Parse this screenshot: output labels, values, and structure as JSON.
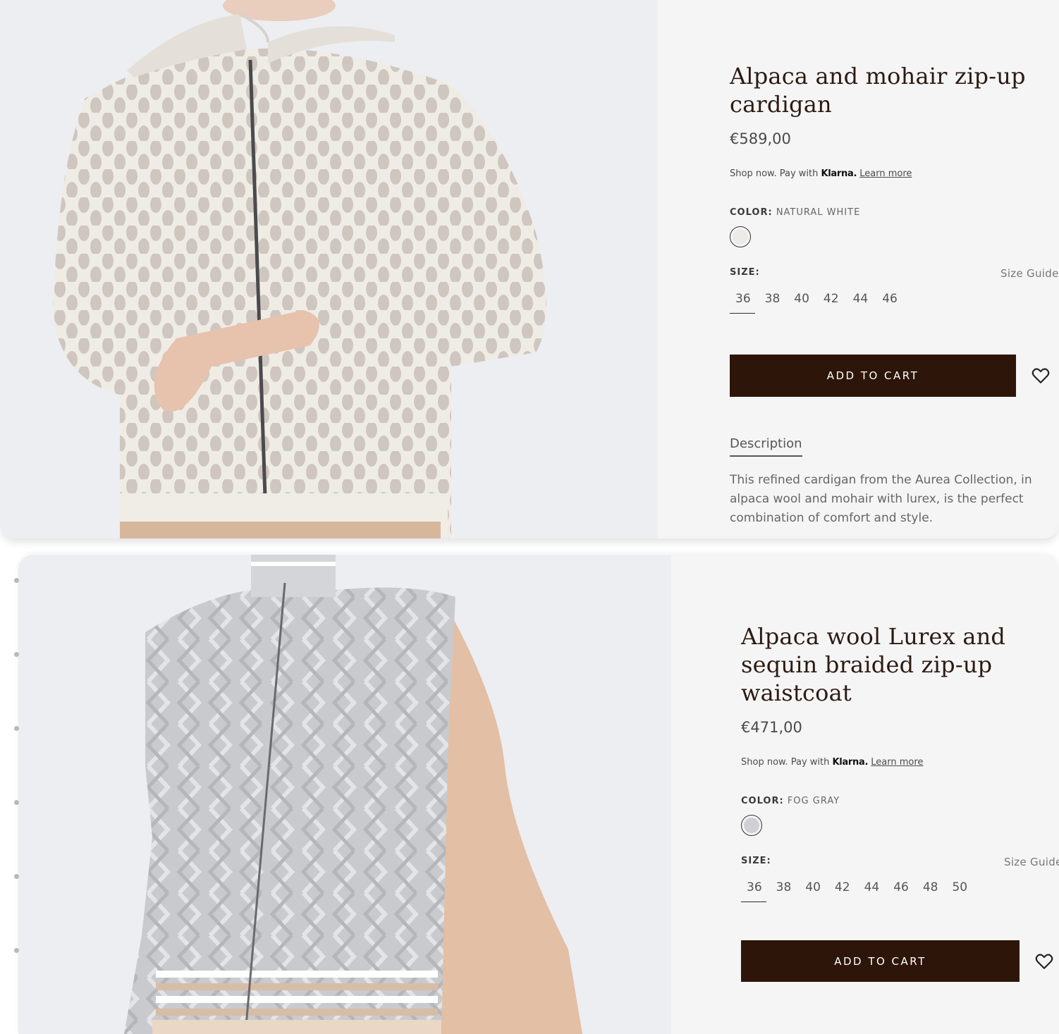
{
  "products": [
    {
      "title": "Alpaca and mohair zip-up cardigan",
      "price": "€589,00",
      "klarna": {
        "prefix": "Shop now. Pay with",
        "brand": "Klarna.",
        "link": "Learn more"
      },
      "color_label": "COLOR:",
      "color_value": "NATURAL WHITE",
      "swatch_color": "#ecebe7",
      "size_label": "SIZE:",
      "size_guide": "Size Guide",
      "sizes": [
        "36",
        "38",
        "40",
        "42",
        "44",
        "46"
      ],
      "selected_size": "36",
      "cart_label": "ADD TO CART",
      "description_tab": "Description",
      "description": "This refined cardigan from the Aurea Collection, in alpaca wool and mohair with lurex, is the perfect combination of comfort and style."
    },
    {
      "title": "Alpaca wool Lurex and sequin braided zip-up waistcoat",
      "price": "€471,00",
      "klarna": {
        "prefix": "Shop now. Pay with",
        "brand": "Klarna.",
        "link": "Learn more"
      },
      "color_label": "COLOR:",
      "color_value": "FOG GRAY",
      "swatch_color": "#cfd0d4",
      "size_label": "SIZE:",
      "size_guide": "Size Guide",
      "sizes": [
        "36",
        "38",
        "40",
        "42",
        "44",
        "46",
        "48",
        "50"
      ],
      "selected_size": "36",
      "cart_label": "ADD TO CART"
    }
  ],
  "colors": {
    "button": "#2d1609",
    "card_bg": "#f5f5f6",
    "title": "#2d1a12"
  }
}
